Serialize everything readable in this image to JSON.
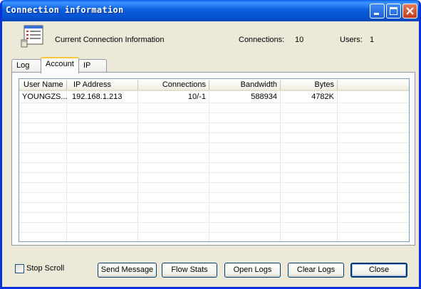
{
  "window": {
    "title": "Connection information"
  },
  "header": {
    "icon": "connection-list-icon",
    "title": "Current Connection Information",
    "connections_label": "Connections:",
    "connections_value": "10",
    "users_label": "Users:",
    "users_value": "1"
  },
  "tabs": [
    {
      "label": "Log",
      "active": false
    },
    {
      "label": "Account",
      "active": true
    },
    {
      "label": "IP",
      "active": false
    }
  ],
  "table": {
    "columns": [
      "User Name",
      "IP Address",
      "Connections",
      "Bandwidth",
      "Bytes"
    ],
    "rows": [
      [
        "YOUNGZS...",
        "192.168.1.213",
        "10/-1",
        "588934",
        "4782K"
      ]
    ]
  },
  "footer": {
    "stop_scroll_label": "Stop Scroll",
    "stop_scroll_checked": false,
    "buttons": [
      "Send Message",
      "Flow Stats",
      "Open Logs",
      "Clear Logs",
      "Close"
    ]
  },
  "colors": {
    "titlebar": "#0a5fdc",
    "active_tab_accent": "#ffc83c",
    "window_bg": "#ece9d8"
  }
}
